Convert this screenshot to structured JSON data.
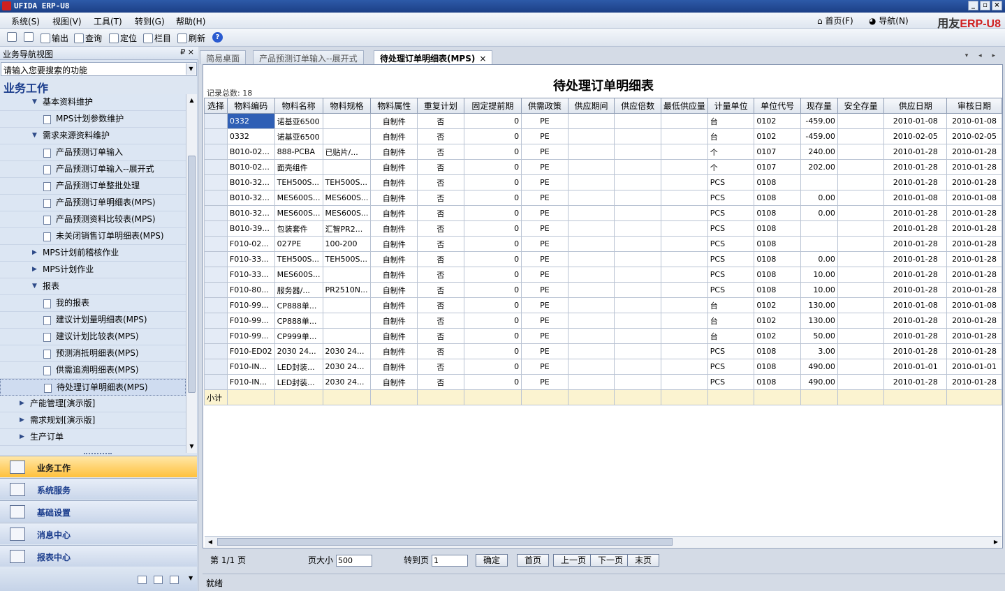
{
  "window": {
    "title": "UFIDA ERP-U8",
    "controls": [
      "_",
      "▫",
      "×"
    ]
  },
  "menu": [
    "系统(S)",
    "视图(V)",
    "工具(T)",
    "转到(G)",
    "帮助(H)"
  ],
  "topnav": {
    "home": "首页(F)",
    "nav": "导航(N)",
    "brand_a": "用友",
    "brand_b": "ERP-U8"
  },
  "toolbar": {
    "output": "输出",
    "query": "查询",
    "locate": "定位",
    "columns": "栏目",
    "refresh": "刷新",
    "help": "?"
  },
  "left": {
    "header": "业务导航视图",
    "pin": "₽ ×",
    "search_placeholder": "请输入您要搜索的功能",
    "section_title": "业务工作",
    "tree": [
      {
        "label": "基本资料维护",
        "level": 1,
        "type": "folder",
        "open": true
      },
      {
        "label": "MPS计划参数维护",
        "level": 2,
        "type": "doc"
      },
      {
        "label": "需求来源资料维护",
        "level": 1,
        "type": "folder",
        "open": true
      },
      {
        "label": "产品预测订单输入",
        "level": 2,
        "type": "doc"
      },
      {
        "label": "产品预测订单输入--展开式",
        "level": 2,
        "type": "doc"
      },
      {
        "label": "产品预测订单整批处理",
        "level": 2,
        "type": "doc"
      },
      {
        "label": "产品预测订单明细表(MPS)",
        "level": 2,
        "type": "doc"
      },
      {
        "label": "产品预测资料比较表(MPS)",
        "level": 2,
        "type": "doc"
      },
      {
        "label": "未关闭销售订单明细表(MPS)",
        "level": 2,
        "type": "doc"
      },
      {
        "label": "MPS计划前稽核作业",
        "level": 1,
        "type": "folder",
        "open": false
      },
      {
        "label": "MPS计划作业",
        "level": 1,
        "type": "folder",
        "open": false
      },
      {
        "label": "报表",
        "level": 1,
        "type": "folder",
        "open": true
      },
      {
        "label": "我的报表",
        "level": 2,
        "type": "doc"
      },
      {
        "label": "建议计划量明细表(MPS)",
        "level": 2,
        "type": "doc"
      },
      {
        "label": "建议计划比较表(MPS)",
        "level": 2,
        "type": "doc"
      },
      {
        "label": "预测消抵明细表(MPS)",
        "level": 2,
        "type": "doc"
      },
      {
        "label": "供需追溯明细表(MPS)",
        "level": 2,
        "type": "doc"
      },
      {
        "label": "待处理订单明细表(MPS)",
        "level": 2,
        "type": "doc",
        "selected": true
      },
      {
        "label": "产能管理[演示版]",
        "level": 0,
        "type": "folder",
        "open": false
      },
      {
        "label": "需求规划[演示版]",
        "level": 0,
        "type": "folder",
        "open": false
      },
      {
        "label": "生产订单",
        "level": 0,
        "type": "folder",
        "open": false
      }
    ],
    "nav_buttons": [
      {
        "label": "业务工作",
        "active": true
      },
      {
        "label": "系统服务",
        "active": false
      },
      {
        "label": "基础设置",
        "active": false
      },
      {
        "label": "消息中心",
        "active": false
      },
      {
        "label": "报表中心",
        "active": false
      }
    ]
  },
  "tabs": [
    {
      "label": "简易桌面",
      "active": false
    },
    {
      "label": "产品预测订单输入--展开式",
      "active": false
    },
    {
      "label": "待处理订单明细表(MPS)",
      "active": true,
      "close": "×"
    }
  ],
  "tabnav": "▾ ◂ ▸",
  "report": {
    "title": "待处理订单明细表",
    "record_count": "记录总数: 18",
    "columns": [
      "选择",
      "物料编码",
      "物料名称",
      "物料规格",
      "物料属性",
      "重复计划",
      "固定提前期",
      "供需政策",
      "供应期间",
      "供应倍数",
      "最低供应量",
      "计量单位",
      "单位代号",
      "现存量",
      "安全存量",
      "供应日期",
      "审核日期"
    ],
    "rows": [
      [
        "",
        "0332",
        "诺基亚6500",
        "",
        "自制件",
        "否",
        "0",
        "PE",
        "",
        "",
        "",
        "台",
        "0102",
        "-459.00",
        "",
        "2010-01-08",
        "2010-01-08"
      ],
      [
        "",
        "0332",
        "诺基亚6500",
        "",
        "自制件",
        "否",
        "0",
        "PE",
        "",
        "",
        "",
        "台",
        "0102",
        "-459.00",
        "",
        "2010-02-05",
        "2010-02-05"
      ],
      [
        "",
        "B010-02...",
        "888-PCBA",
        "已贴片/...",
        "自制件",
        "否",
        "0",
        "PE",
        "",
        "",
        "",
        "个",
        "0107",
        "240.00",
        "",
        "2010-01-28",
        "2010-01-28"
      ],
      [
        "",
        "B010-02...",
        "面壳组件",
        "",
        "自制件",
        "否",
        "0",
        "PE",
        "",
        "",
        "",
        "个",
        "0107",
        "202.00",
        "",
        "2010-01-28",
        "2010-01-28"
      ],
      [
        "",
        "B010-32...",
        "TEH500S...",
        "TEH500S...",
        "自制件",
        "否",
        "0",
        "PE",
        "",
        "",
        "",
        "PCS",
        "0108",
        "",
        "",
        "2010-01-28",
        "2010-01-28"
      ],
      [
        "",
        "B010-32...",
        "MES600S...",
        "MES600S...",
        "自制件",
        "否",
        "0",
        "PE",
        "",
        "",
        "",
        "PCS",
        "0108",
        "0.00",
        "",
        "2010-01-08",
        "2010-01-08"
      ],
      [
        "",
        "B010-32...",
        "MES600S...",
        "MES600S...",
        "自制件",
        "否",
        "0",
        "PE",
        "",
        "",
        "",
        "PCS",
        "0108",
        "0.00",
        "",
        "2010-01-28",
        "2010-01-28"
      ],
      [
        "",
        "B010-39...",
        "包装套件",
        "汇智PR2...",
        "自制件",
        "否",
        "0",
        "PE",
        "",
        "",
        "",
        "PCS",
        "0108",
        "",
        "",
        "2010-01-28",
        "2010-01-28"
      ],
      [
        "",
        "F010-02...",
        "027PE",
        "100-200",
        "自制件",
        "否",
        "0",
        "PE",
        "",
        "",
        "",
        "PCS",
        "0108",
        "",
        "",
        "2010-01-28",
        "2010-01-28"
      ],
      [
        "",
        "F010-33...",
        "TEH500S...",
        "TEH500S...",
        "自制件",
        "否",
        "0",
        "PE",
        "",
        "",
        "",
        "PCS",
        "0108",
        "0.00",
        "",
        "2010-01-28",
        "2010-01-28"
      ],
      [
        "",
        "F010-33...",
        "MES600S...",
        "",
        "自制件",
        "否",
        "0",
        "PE",
        "",
        "",
        "",
        "PCS",
        "0108",
        "10.00",
        "",
        "2010-01-28",
        "2010-01-28"
      ],
      [
        "",
        "F010-80...",
        "服务器/...",
        "PR2510N...",
        "自制件",
        "否",
        "0",
        "PE",
        "",
        "",
        "",
        "PCS",
        "0108",
        "10.00",
        "",
        "2010-01-28",
        "2010-01-28"
      ],
      [
        "",
        "F010-99...",
        "CP888单...",
        "",
        "自制件",
        "否",
        "0",
        "PE",
        "",
        "",
        "",
        "台",
        "0102",
        "130.00",
        "",
        "2010-01-08",
        "2010-01-08"
      ],
      [
        "",
        "F010-99...",
        "CP888单...",
        "",
        "自制件",
        "否",
        "0",
        "PE",
        "",
        "",
        "",
        "台",
        "0102",
        "130.00",
        "",
        "2010-01-28",
        "2010-01-28"
      ],
      [
        "",
        "F010-99...",
        "CP999单...",
        "",
        "自制件",
        "否",
        "0",
        "PE",
        "",
        "",
        "",
        "台",
        "0102",
        "50.00",
        "",
        "2010-01-28",
        "2010-01-28"
      ],
      [
        "",
        "F010-ED02",
        "2030 24...",
        "2030 24...",
        "自制件",
        "否",
        "0",
        "PE",
        "",
        "",
        "",
        "PCS",
        "0108",
        "3.00",
        "",
        "2010-01-28",
        "2010-01-28"
      ],
      [
        "",
        "F010-IN...",
        "LED封装...",
        "2030 24...",
        "自制件",
        "否",
        "0",
        "PE",
        "",
        "",
        "",
        "PCS",
        "0108",
        "490.00",
        "",
        "2010-01-01",
        "2010-01-01"
      ],
      [
        "",
        "F010-IN...",
        "LED封装...",
        "2030 24...",
        "自制件",
        "否",
        "0",
        "PE",
        "",
        "",
        "",
        "PCS",
        "0108",
        "490.00",
        "",
        "2010-01-28",
        "2010-01-28"
      ]
    ],
    "subtotal_label": "小计"
  },
  "pager": {
    "page_info": "第 1/1 页",
    "page_size_label": "页大小",
    "page_size": "500",
    "goto_label": "转到页",
    "goto_value": "1",
    "confirm": "确定",
    "first": "首页",
    "prev": "上一页",
    "next": "下一页",
    "last": "末页"
  },
  "status": "就绪"
}
